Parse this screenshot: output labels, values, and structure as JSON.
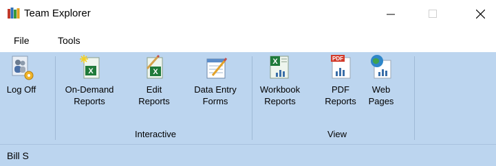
{
  "window": {
    "title": "Team Explorer"
  },
  "menu": {
    "items": [
      "File",
      "Tools"
    ]
  },
  "ribbon": {
    "tools": [
      {
        "label": "Log Off"
      },
      {
        "label": "On-Demand\nReports"
      },
      {
        "label": "Edit\nReports"
      },
      {
        "label": "Data Entry\nForms"
      },
      {
        "label": "Workbook\nReports"
      },
      {
        "label": "PDF\nReports"
      },
      {
        "label": "Web\nPages"
      }
    ],
    "groups": [
      "Interactive",
      "View"
    ]
  },
  "status": {
    "user": "Bill S"
  },
  "colors": {
    "ribbon_bg": "#bcd5ef",
    "excel_green": "#1f7a3a",
    "pdf_red": "#d23a2a"
  },
  "icons": {
    "app": "books-icon",
    "log_off": "users-gear-icon",
    "on_demand": "excel-sparkle-icon",
    "edit": "excel-pencil-icon",
    "data_entry": "form-pencil-icon",
    "workbook": "excel-chart-icon",
    "pdf": "pdf-chart-icon",
    "web": "globe-chart-icon"
  }
}
